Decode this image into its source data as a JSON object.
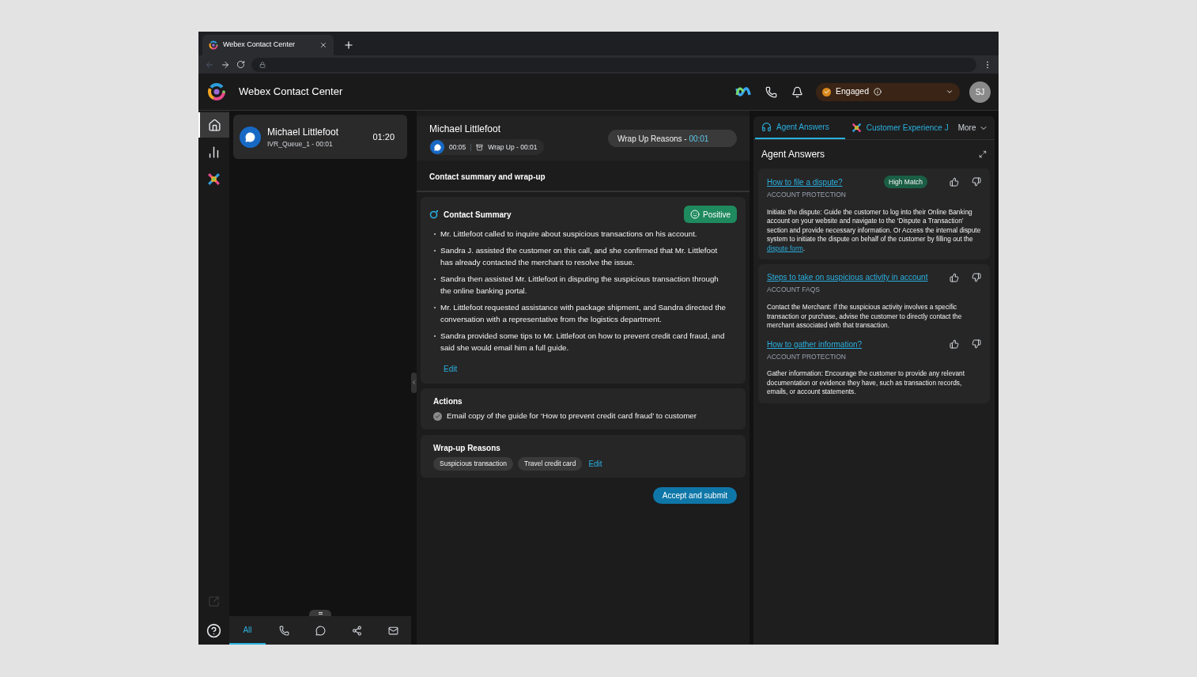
{
  "browser": {
    "tab_title": "Webex Contact Center"
  },
  "header": {
    "title": "Webex Contact Center",
    "status": "Engaged",
    "avatar": "SJ"
  },
  "nav_rail": [
    {
      "kind": "home",
      "selected": true
    },
    {
      "kind": "stats",
      "selected": false
    },
    {
      "kind": "app",
      "selected": false
    }
  ],
  "contact_card": {
    "name": "Michael Littlefoot",
    "queue": "IVR_Queue_1 - 00:01",
    "time": "01:20"
  },
  "filter_tabs": [
    {
      "kind": "all",
      "label": "All",
      "selected": true
    },
    {
      "kind": "phone",
      "selected": false
    },
    {
      "kind": "chat",
      "selected": false
    },
    {
      "kind": "social",
      "selected": false
    },
    {
      "kind": "email",
      "selected": false
    }
  ],
  "interaction": {
    "name": "Michael Littlefoot",
    "chat_time": "00:05",
    "wrap_up": "Wrap Up - 00:01",
    "reasons_label": "Wrap Up Reasons - ",
    "reasons_time": "00:01"
  },
  "section_title": "Contact summary and wrap-up",
  "summary": {
    "title": "Contact Summary",
    "sentiment": "Positive",
    "edit": "Edit",
    "bullets": [
      "Mr. Littlefoot called to inquire about suspicious transactions on his account.",
      "Sandra J. assisted the customer on this call, and she confirmed that Mr. Littlefoot has already contacted the merchant to resolve the issue.",
      "Sandra then assisted Mr. Littlefoot in disputing the suspicious transaction through the online banking portal.",
      "Mr. Littlefoot requested assistance with package shipment, and Sandra directed the conversation with a representative from the logistics department.",
      "Sandra provided some tips to Mr. Littlefoot on how to prevent credit card fraud, and said she would email him a full guide."
    ]
  },
  "actions": {
    "title": "Actions",
    "items": [
      {
        "text": "Email copy of the guide for ‘How to prevent credit card fraud’ to customer",
        "checked": true
      }
    ]
  },
  "wrap_up": {
    "title": "Wrap-up Reasons",
    "tags": [
      "Suspicious transaction",
      "Travel credit card"
    ],
    "edit": "Edit"
  },
  "submit": "Accept and submit",
  "right_tabs": [
    {
      "kind": "headset",
      "label": "Agent Answers",
      "selected": true
    },
    {
      "kind": "cx",
      "label": "Customer Experience J",
      "selected": false
    }
  ],
  "more": "More",
  "answers": {
    "title": "Agent Answers",
    "cards": [
      {
        "items": [
          {
            "title": "How to file a dispute?",
            "badge": "High Match",
            "category": "ACCOUNT PROTECTION",
            "body": "Initiate the dispute: Guide the customer to log into their Online Banking account on your website and navigate to the ‘Dispute a Transaction’ section and provide necessary information. Or Access the internal dispute system to initiate the dispute on behalf of the customer by filling out the ",
            "link": "dispute form",
            "body_end": "."
          }
        ]
      },
      {
        "items": [
          {
            "title": "Steps to take on suspicious activity in account",
            "category": "ACCOUNT FAQS",
            "body": "Contact the Merchant: If the suspicious activity involves a specific transaction or purchase, advise the customer to directly contact the merchant associated with that transaction."
          },
          {
            "title": "How to gather information?",
            "category": "ACCOUNT PROTECTION",
            "body": "Gather information: Encourage the customer to provide any relevant documentation or evidence they have, such as transaction records, emails, or account statements."
          }
        ]
      }
    ]
  }
}
